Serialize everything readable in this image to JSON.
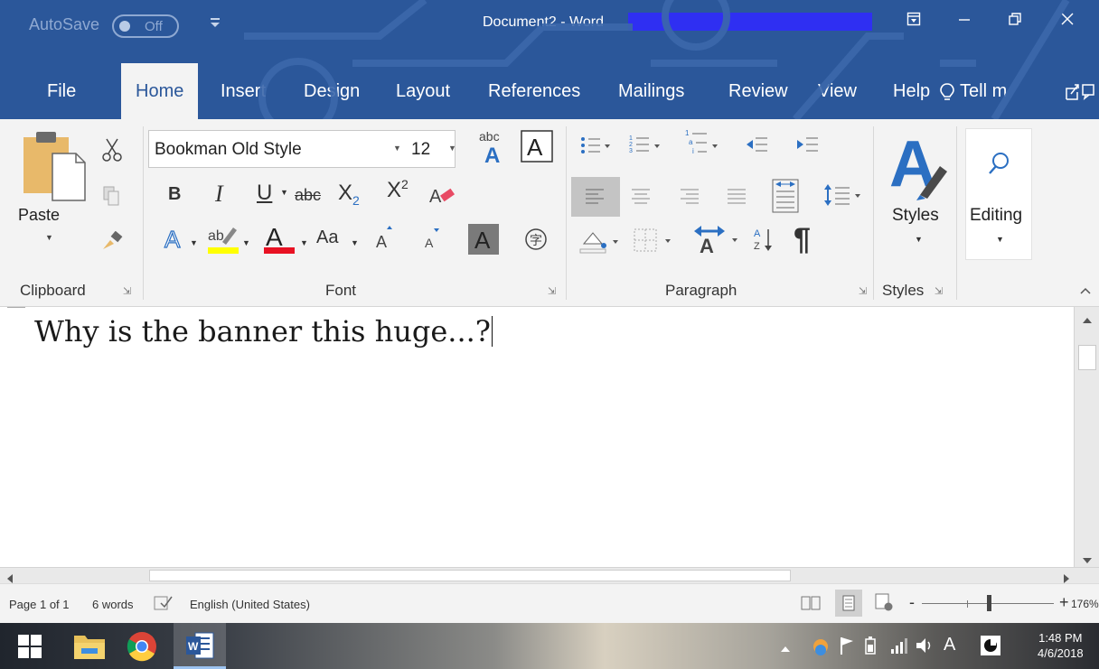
{
  "titlebar": {
    "autosave_label": "AutoSave",
    "autosave_state": "Off",
    "doc_title": "Document2  -  Word",
    "window_controls": [
      "ribbon-display-icon",
      "minimize-icon",
      "restore-icon",
      "close-icon"
    ]
  },
  "tabs": [
    {
      "label": "File"
    },
    {
      "label": "Home"
    },
    {
      "label": "Insert"
    },
    {
      "label": "Design"
    },
    {
      "label": "Layout"
    },
    {
      "label": "References"
    },
    {
      "label": "Mailings"
    },
    {
      "label": "Review"
    },
    {
      "label": "View"
    },
    {
      "label": "Help"
    }
  ],
  "active_tab": "Home",
  "tell_me": "Tell m",
  "ribbon": {
    "clipboard": {
      "paste_label": "Paste",
      "group_label": "Clipboard"
    },
    "font": {
      "font_name": "Bookman Old Style",
      "font_size": "12",
      "change_case": "Aa",
      "group_label": "Font"
    },
    "paragraph": {
      "group_label": "Paragraph"
    },
    "styles": {
      "label": "Styles",
      "group_label": "Styles"
    },
    "editing": {
      "label": "Editing"
    }
  },
  "document": {
    "text": "Why is the banner this huge...?"
  },
  "statusbar": {
    "page": "Page 1 of 1",
    "words": "6 words",
    "language": "English (United States)",
    "zoom": "176%"
  },
  "taskbar": {
    "time": "1:48 PM",
    "date": "4/6/2018",
    "ime": "A"
  },
  "colors": {
    "word_blue": "#2b579a",
    "ribbon_bg": "#f3f3f3",
    "highlight_yellow": "#ffff00",
    "font_color_red": "#e81123",
    "redaction": "#2f2ff2"
  }
}
